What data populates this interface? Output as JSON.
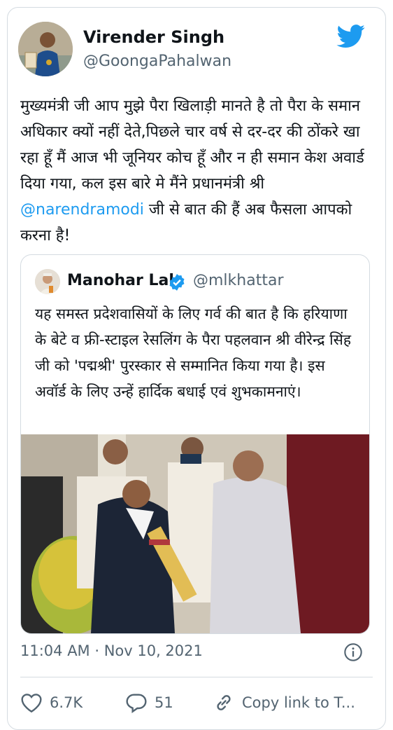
{
  "author": {
    "name": "Virender Singh",
    "handle": "@GoongaPahalwan"
  },
  "tweet": {
    "text_part1": "मुख्यमंत्री जी आप मुझे पैरा खिलाड़ी मानते है तो पैरा के समान अधिकार क्यों नहीं देते,पिछले चार वर्ष से दर-दर की ठोंकरे खा रहा हूँ मैं आज भी जूनियर कोच हूँ और न ही समान केश अवार्ड दिया गया, कल इस बारे मे मैंने प्रधानमंत्री श्री ",
    "mention": "@narendramodi",
    "text_part2": " जी से बात की हैं अब फैसला आपको करना है!"
  },
  "quoted_tweet": {
    "name": "Manohar Lal",
    "handle": "@mlkhattar",
    "text": "यह समस्त प्रदेशवासियों के लिए गर्व की बात है कि हरियाणा के बेटे व फ्री-स्टाइल रेसलिंग के पैरा पहलवान श्री वीरेन्द्र सिंह जी को 'पद्मश्री' पुरस्कार से सम्मानित किया गया है। इस अवॉर्ड के लिए उन्हें हार्दिक बधाई एवं शुभकामनाएं।"
  },
  "meta": {
    "timestamp": "11:04 AM · Nov 10, 2021"
  },
  "actions": {
    "likes": "6.7K",
    "replies": "51",
    "copy_link": "Copy link to T..."
  },
  "colors": {
    "accent": "#1d9bf0",
    "secondary_text": "#536471",
    "border": "#d4dbe1"
  },
  "icons": [
    "twitter-bird-icon",
    "verified-badge-icon",
    "info-icon",
    "heart-icon",
    "reply-icon",
    "link-icon"
  ]
}
